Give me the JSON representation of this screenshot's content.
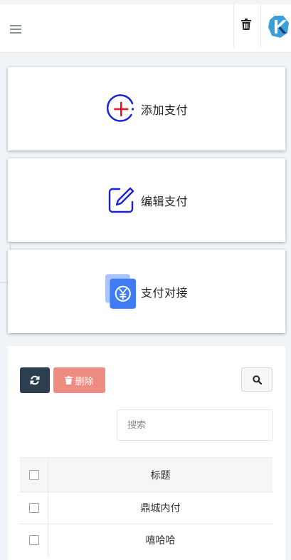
{
  "header": {
    "menu_icon": "hamburger-icon",
    "trash_icon": "trash-icon",
    "logo_icon": "app-logo"
  },
  "cards": [
    {
      "label": "添加支付",
      "icon": "add-circle-icon",
      "accent": "#1a23d6",
      "plus_color": "#e0162b"
    },
    {
      "label": "编辑支付",
      "icon": "edit-icon",
      "accent": "#1a23d6"
    },
    {
      "label": "支付对接",
      "icon": "yuan-payment-icon",
      "accent": "#3d7cf5"
    }
  ],
  "toolbar": {
    "refresh_icon": "refresh-icon",
    "delete_label": "删除",
    "search_icon": "search-icon"
  },
  "search": {
    "placeholder": "搜索",
    "value": ""
  },
  "table": {
    "columns": [
      "标题"
    ],
    "rows": [
      {
        "title": "鼎城内付"
      },
      {
        "title": "嘻哈哈"
      }
    ]
  },
  "colors": {
    "refresh_btn": "#2c3e50",
    "delete_btn": "#ee8c82"
  }
}
